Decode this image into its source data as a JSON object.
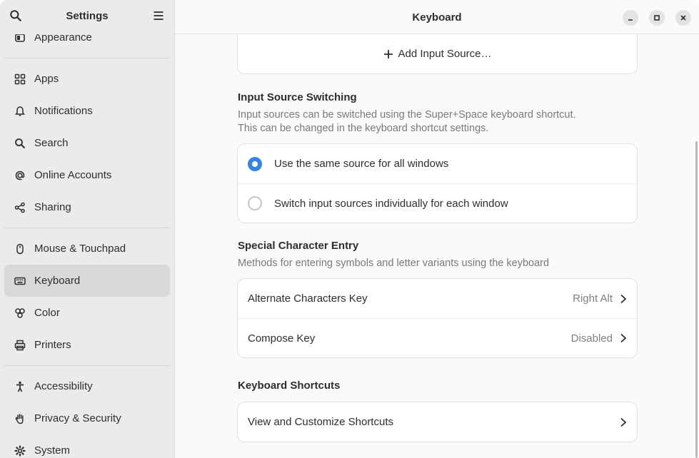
{
  "sidebar": {
    "title": "Settings",
    "items": [
      {
        "label": "Appearance",
        "icon": "appearance-icon",
        "name": "sidebar-item-appearance"
      },
      {
        "label": "Apps",
        "icon": "apps-icon",
        "name": "sidebar-item-apps"
      },
      {
        "label": "Notifications",
        "icon": "bell-icon",
        "name": "sidebar-item-notifications"
      },
      {
        "label": "Search",
        "icon": "search-icon",
        "name": "sidebar-item-search"
      },
      {
        "label": "Online Accounts",
        "icon": "at-icon",
        "name": "sidebar-item-online-accounts"
      },
      {
        "label": "Sharing",
        "icon": "share-icon",
        "name": "sidebar-item-sharing"
      },
      {
        "label": "Mouse & Touchpad",
        "icon": "mouse-icon",
        "name": "sidebar-item-mouse-touchpad"
      },
      {
        "label": "Keyboard",
        "icon": "keyboard-icon",
        "name": "sidebar-item-keyboard"
      },
      {
        "label": "Color",
        "icon": "color-icon",
        "name": "sidebar-item-color"
      },
      {
        "label": "Printers",
        "icon": "printer-icon",
        "name": "sidebar-item-printers"
      },
      {
        "label": "Accessibility",
        "icon": "accessibility-icon",
        "name": "sidebar-item-accessibility"
      },
      {
        "label": "Privacy & Security",
        "icon": "hand-icon",
        "name": "sidebar-item-privacy-security"
      },
      {
        "label": "System",
        "icon": "gear-icon",
        "name": "sidebar-item-system"
      }
    ],
    "active": "Keyboard"
  },
  "header": {
    "title": "Keyboard"
  },
  "input_sources": {
    "add_label": "Add Input Source…"
  },
  "switching": {
    "title": "Input Source Switching",
    "desc_line1": "Input sources can be switched using the Super+Space keyboard shortcut.",
    "desc_line2": "This can be changed in the keyboard shortcut settings.",
    "options": [
      {
        "label": "Use the same source for all windows",
        "selected": true
      },
      {
        "label": "Switch input sources individually for each window",
        "selected": false
      }
    ]
  },
  "special": {
    "title": "Special Character Entry",
    "desc": "Methods for entering symbols and letter variants using the keyboard",
    "rows": [
      {
        "label": "Alternate Characters Key",
        "value": "Right Alt"
      },
      {
        "label": "Compose Key",
        "value": "Disabled"
      }
    ]
  },
  "shortcuts": {
    "title": "Keyboard Shortcuts",
    "row_label": "View and Customize Shortcuts"
  },
  "colors": {
    "accent": "#3584e4",
    "sidebar_bg": "#ebebed",
    "content_bg": "#fafafb"
  }
}
